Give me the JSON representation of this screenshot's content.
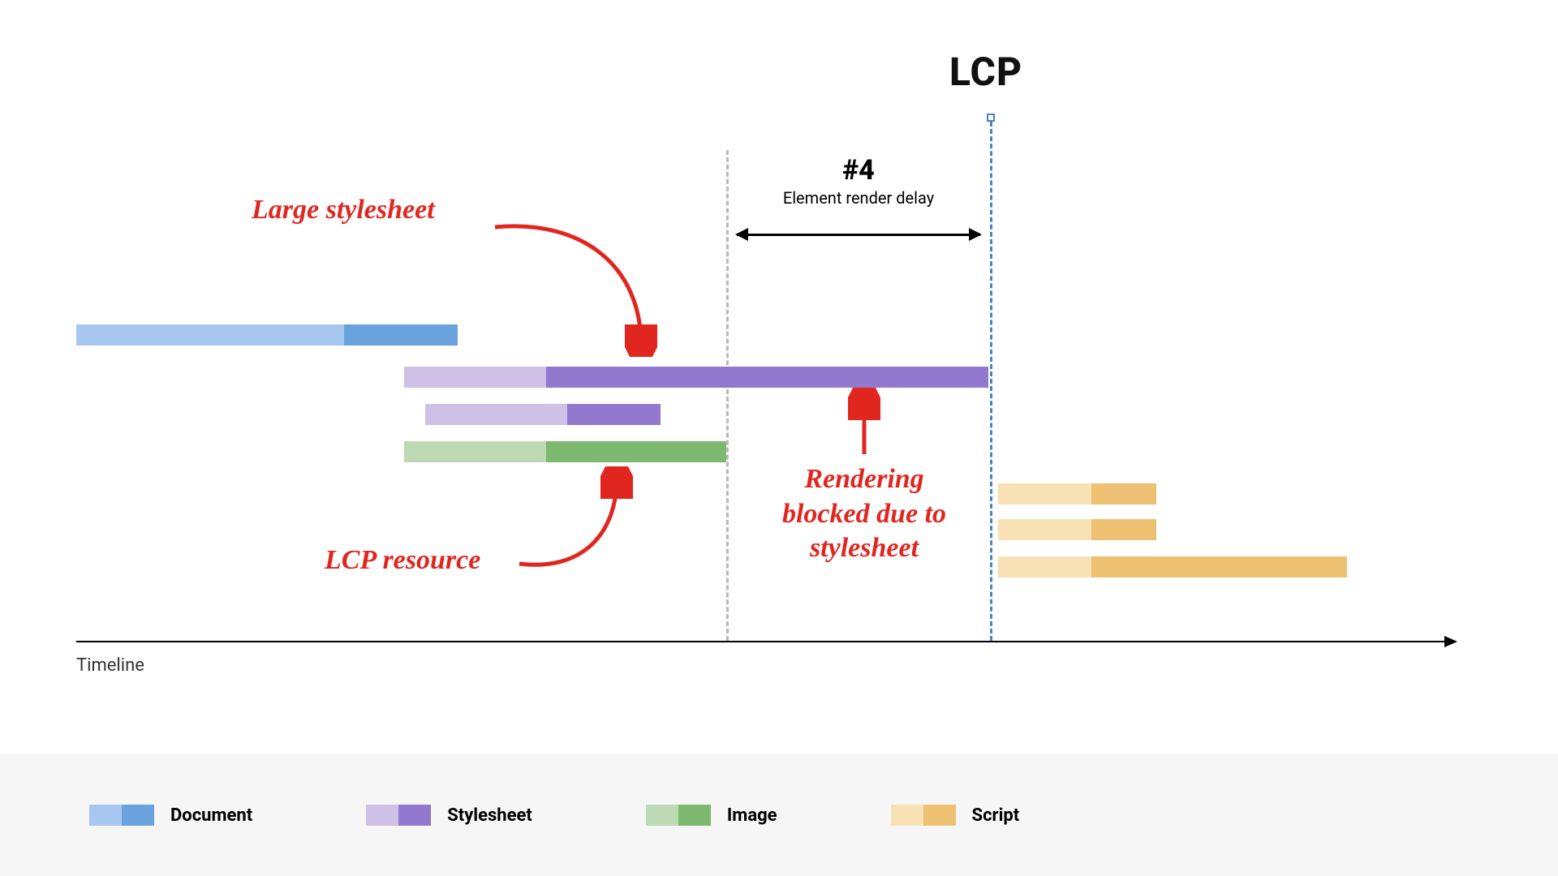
{
  "title": "LCP",
  "section": {
    "num": "#4",
    "sub": "Element render delay"
  },
  "annotations": {
    "large_stylesheet": "Large stylesheet",
    "lcp_resource": "LCP resource",
    "render_blocked": "Rendering blocked due to stylesheet"
  },
  "axis_label": "Timeline",
  "legend": {
    "document": "Document",
    "stylesheet": "Stylesheet",
    "image": "Image",
    "script": "Script"
  },
  "chart_data": {
    "type": "gantt-timeline",
    "x_range": [
      0,
      100
    ],
    "markers": {
      "render_delay_start": 55,
      "lcp": 76
    },
    "bars": [
      {
        "name": "document",
        "type": "document",
        "start": 2,
        "split": 23,
        "end": 31
      },
      {
        "name": "stylesheet-large",
        "type": "stylesheet",
        "start": 27,
        "split": 38,
        "end": 76
      },
      {
        "name": "stylesheet-2",
        "type": "stylesheet",
        "start": 29,
        "split": 41,
        "end": 50
      },
      {
        "name": "image-lcp",
        "type": "image",
        "start": 27,
        "split": 38,
        "end": 55
      },
      {
        "name": "script-1",
        "type": "script",
        "start": 77,
        "split": 85,
        "end": 90
      },
      {
        "name": "script-2",
        "type": "script",
        "start": 77,
        "split": 85,
        "end": 90
      },
      {
        "name": "script-3",
        "type": "script",
        "start": 77,
        "split": 85,
        "end": 105
      }
    ],
    "segment": {
      "label": "#4 Element render delay",
      "from": 55,
      "to": 76
    }
  }
}
